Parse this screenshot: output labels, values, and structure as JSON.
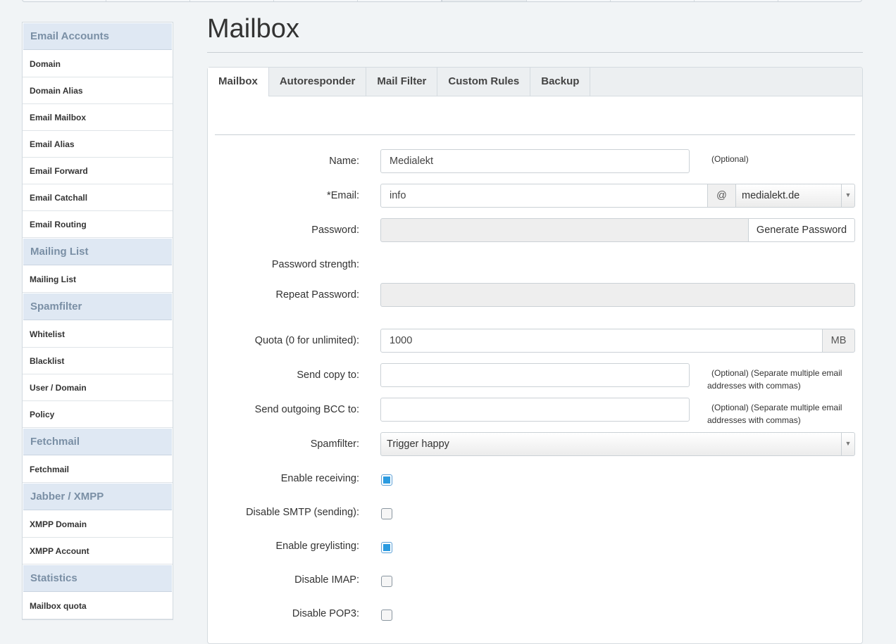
{
  "page_title": "Mailbox",
  "sidebar": {
    "sections": [
      {
        "title": "Email Accounts",
        "items": [
          "Domain",
          "Domain Alias",
          "Email Mailbox",
          "Email Alias",
          "Email Forward",
          "Email Catchall",
          "Email Routing"
        ]
      },
      {
        "title": "Mailing List",
        "items": [
          "Mailing List"
        ]
      },
      {
        "title": "Spamfilter",
        "items": [
          "Whitelist",
          "Blacklist",
          "User / Domain",
          "Policy"
        ]
      },
      {
        "title": "Fetchmail",
        "items": [
          "Fetchmail"
        ]
      },
      {
        "title": "Jabber / XMPP",
        "items": [
          "XMPP Domain",
          "XMPP Account"
        ]
      },
      {
        "title": "Statistics",
        "items": [
          "Mailbox quota"
        ]
      }
    ]
  },
  "tabs": [
    {
      "label": "Mailbox",
      "active": true
    },
    {
      "label": "Autoresponder",
      "active": false
    },
    {
      "label": "Mail Filter",
      "active": false
    },
    {
      "label": "Custom Rules",
      "active": false
    },
    {
      "label": "Backup",
      "active": false
    }
  ],
  "form": {
    "name": {
      "label": "Name:",
      "value": "Medialekt",
      "hint": "(Optional)"
    },
    "email": {
      "required_mark": "*",
      "label": "Email:",
      "local": "info",
      "at": "@",
      "domain": "medialekt.de"
    },
    "password": {
      "label": "Password:",
      "value": "",
      "button": "Generate Password"
    },
    "password_strength": {
      "label": "Password strength:"
    },
    "repeat_password": {
      "label": "Repeat Password:",
      "value": ""
    },
    "quota": {
      "label": "Quota (0 for unlimited):",
      "value": "1000",
      "unit": "MB"
    },
    "send_copy": {
      "label": "Send copy to:",
      "value": "",
      "hint": "(Optional) (Separate multiple email addresses with commas)"
    },
    "send_bcc": {
      "label": "Send outgoing BCC to:",
      "value": "",
      "hint": "(Optional) (Separate multiple email addresses with commas)"
    },
    "spamfilter": {
      "label": "Spamfilter:",
      "value": "Trigger happy"
    },
    "enable_receiving": {
      "label": "Enable receiving:",
      "checked": true
    },
    "disable_smtp": {
      "label": "Disable SMTP (sending):",
      "checked": false
    },
    "enable_greylisting": {
      "label": "Enable greylisting:",
      "checked": true
    },
    "disable_imap": {
      "label": "Disable IMAP:",
      "checked": false
    },
    "disable_pop3": {
      "label": "Disable POP3:",
      "checked": false
    }
  }
}
